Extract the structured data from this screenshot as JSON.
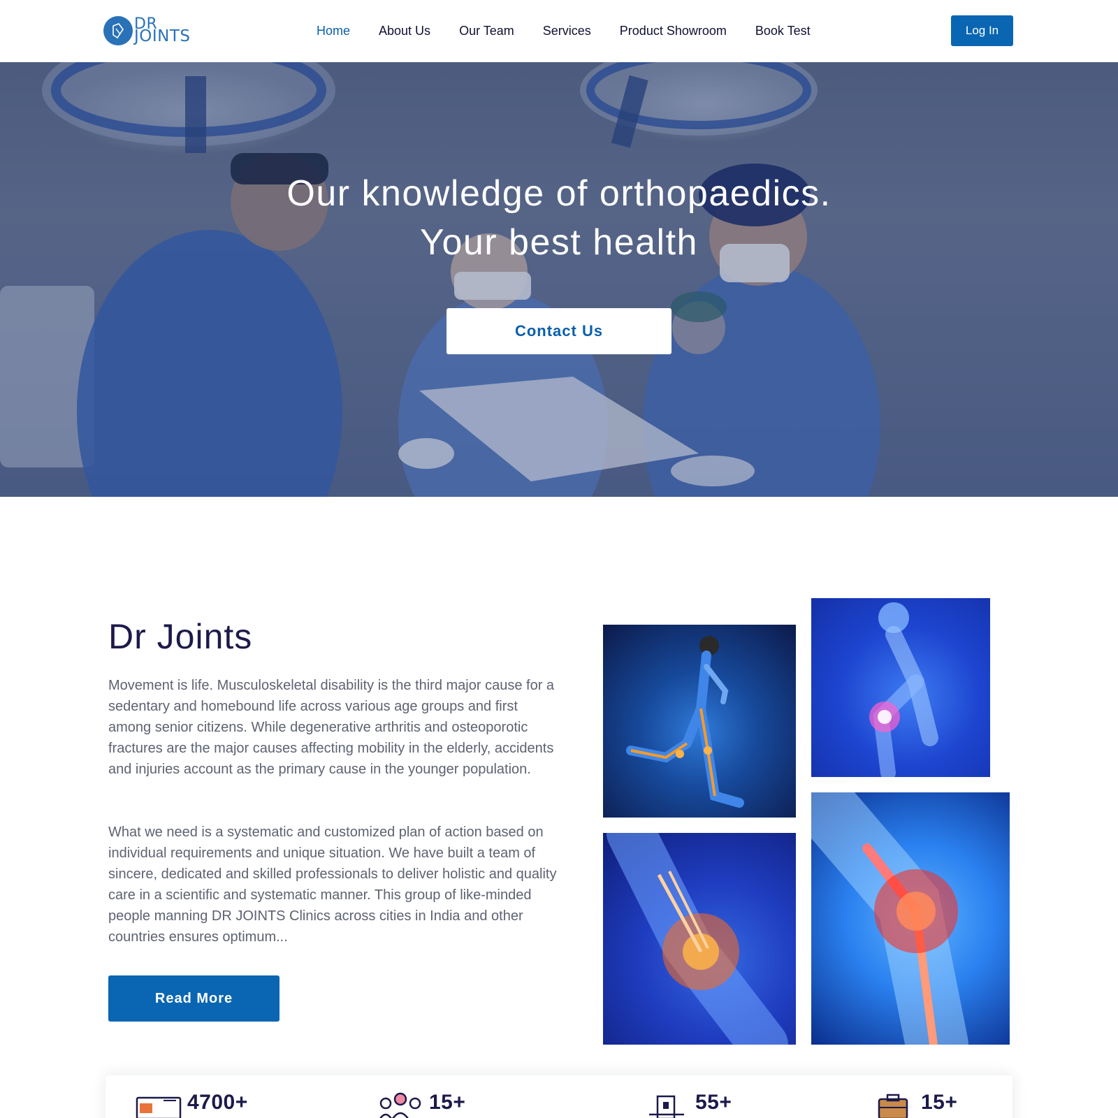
{
  "header": {
    "logo": {
      "line1": "DR",
      "line2": "JOINTS"
    },
    "nav": [
      {
        "label": "Home"
      },
      {
        "label": "About Us"
      },
      {
        "label": "Our Team"
      },
      {
        "label": "Services"
      },
      {
        "label": "Product Showroom"
      },
      {
        "label": "Book Test"
      }
    ],
    "active_nav": "Home",
    "login_label": "Log In"
  },
  "hero": {
    "title_line1": "Our knowledge of orthopaedics.",
    "title_line2": "Your best health",
    "contact_label": "Contact Us"
  },
  "about": {
    "title": "Dr Joints",
    "paragraph1": "Movement is life. Musculoskeletal disability is the third major cause for a sedentary and homebound life across various age groups and first among senior citizens. While degenerative arthritis and osteoporotic fractures are the major causes affecting mobility in the elderly, accidents and injuries account as the primary cause in the younger population.",
    "paragraph2": "What we need is a systematic and customized plan of action based on individual requirements and unique situation. We have built a team of sincere, dedicated and skilled professionals to deliver holistic and quality care in a scientific and systematic manner. This group of like-minded people manning DR JOINTS Clinics across cities in India and other countries ensures optimum...",
    "read_more_label": "Read More"
  },
  "stats": [
    {
      "value": "4700+",
      "icon": "monitor-chart-icon"
    },
    {
      "value": "15+",
      "icon": "team-people-icon"
    },
    {
      "value": "55+",
      "icon": "clinic-building-icon"
    },
    {
      "value": "15+",
      "icon": "briefcase-icon"
    }
  ],
  "colors": {
    "brand_blue": "#0a66b2",
    "heading_navy": "#1c1a4a",
    "body_text": "#5e6272"
  }
}
